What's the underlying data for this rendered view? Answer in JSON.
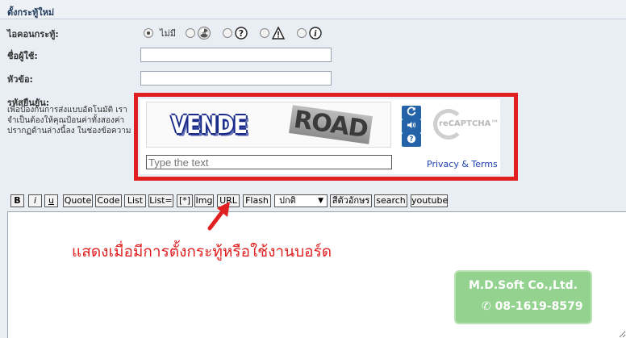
{
  "header": {
    "title": "ตั้งกระทู้ใหม่"
  },
  "form": {
    "icon_label": "ไอคอนกระทู้:",
    "icon_none_label": "ไม่มี",
    "icons": [
      "radiation-icon",
      "question-icon",
      "warning-icon",
      "info-icon"
    ],
    "username_label": "ชื่อผู้ใช้:",
    "subject_label": "หัวข้อ:",
    "captcha_label": "รหัสยืนยัน:",
    "captcha_desc": [
      "เพื่อป้องกันการส่งแบบอัตโนมัติ เรา",
      "จำเป็นต้องให้คุณป้อนค่าทั้งสองค่า",
      "ปรากฏด้านล่างนี้ลง ในช่องข้อความ"
    ]
  },
  "captcha": {
    "word1": "VENDE",
    "word2": "ROAD",
    "input_placeholder": "Type the text",
    "logo_text": "reCAPTCHA™",
    "privacy_link": "Privacy & Terms"
  },
  "toolbar": {
    "buttons": [
      "B",
      "i",
      "u",
      "Quote",
      "Code",
      "List",
      "List=",
      "[*]",
      "Img",
      "URL",
      "Flash"
    ],
    "font_size_value": "ปกติ",
    "color_button": "สีตัวอักษร",
    "search_button": "search",
    "youtube_button": "youtube"
  },
  "annotation": {
    "text": "แสดงเมื่อมีการตั้งกระทู้หรือใช้งานบอร์ด"
  },
  "watermark": {
    "company": "M.D.Soft Co.,Ltd.",
    "phone": "08-1619-8579"
  },
  "colors": {
    "highlight": "#e02020",
    "link": "#1a3fb0",
    "captcha_button": "#2463a8",
    "watermark_bg": "#8fd08a"
  }
}
